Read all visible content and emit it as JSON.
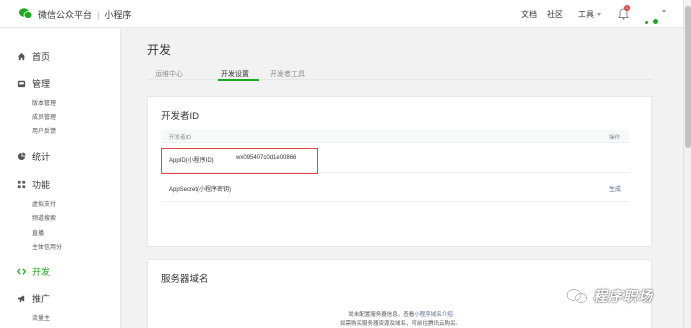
{
  "header": {
    "brand": "微信公众平台",
    "separator": "|",
    "product": "小程序",
    "nav": [
      "文档",
      "社区",
      "工具"
    ],
    "badge_count": "1"
  },
  "sidebar": {
    "home": "首页",
    "manage": "管理",
    "manage_items": [
      "版本管理",
      "成员管理",
      "用户反馈"
    ],
    "stats": "统计",
    "features": "功能",
    "feature_items": [
      "虚拟支付",
      "频道搜索",
      "直播",
      "主体信用分"
    ],
    "develop": "开发",
    "promote": "推广",
    "promote_items": [
      "流量主"
    ]
  },
  "main": {
    "title": "开发",
    "tabs": [
      "运维中心",
      "开发设置",
      "开发者工具"
    ],
    "active_tab": "开发设置"
  },
  "developer_id": {
    "title": "开发者ID",
    "col_label": "开发者ID",
    "col_action": "操作",
    "appid_label": "AppID(小程序ID)",
    "appid_value": "wx095407c0d1e00866",
    "secret_label": "AppSecret(小程序密钥)",
    "secret_action": "生成"
  },
  "server_domain": {
    "title": "服务器域名",
    "line1_prefix": "尚未配置服务器信息，查看",
    "line1_link": "小程序域名介绍",
    "line2": "如需购买服务器资源及域名，可前往腾讯云购买。"
  },
  "watermark": {
    "text": "程序职场"
  },
  "colors": {
    "accent": "#1aad19",
    "highlight_box": "#e64340",
    "link": "#576b95"
  }
}
